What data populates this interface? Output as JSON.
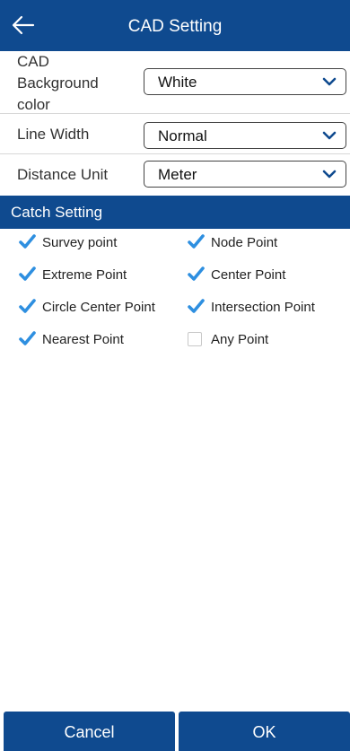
{
  "header": {
    "title": "CAD Setting",
    "back_icon": "arrow-left-icon"
  },
  "settings": {
    "background": {
      "label_line1": "CAD",
      "label_line2": "Background",
      "label_line3": "color",
      "value": "White"
    },
    "line_width": {
      "label": "Line Width",
      "value": "Normal"
    },
    "distance_unit": {
      "label": "Distance Unit",
      "value": "Meter"
    }
  },
  "catch": {
    "title": "Catch Setting",
    "options": [
      {
        "label": "Survey point",
        "checked": true
      },
      {
        "label": "Node Point",
        "checked": true
      },
      {
        "label": "Extreme Point",
        "checked": true
      },
      {
        "label": "Center Point",
        "checked": true
      },
      {
        "label": "Circle Center Point",
        "checked": true
      },
      {
        "label": "Intersection Point",
        "checked": true
      },
      {
        "label": "Nearest Point",
        "checked": true
      },
      {
        "label": "Any Point",
        "checked": false
      }
    ]
  },
  "footer": {
    "cancel_label": "Cancel",
    "ok_label": "OK"
  },
  "colors": {
    "primary": "#0f4a8f",
    "check": "#2e8fe0"
  }
}
